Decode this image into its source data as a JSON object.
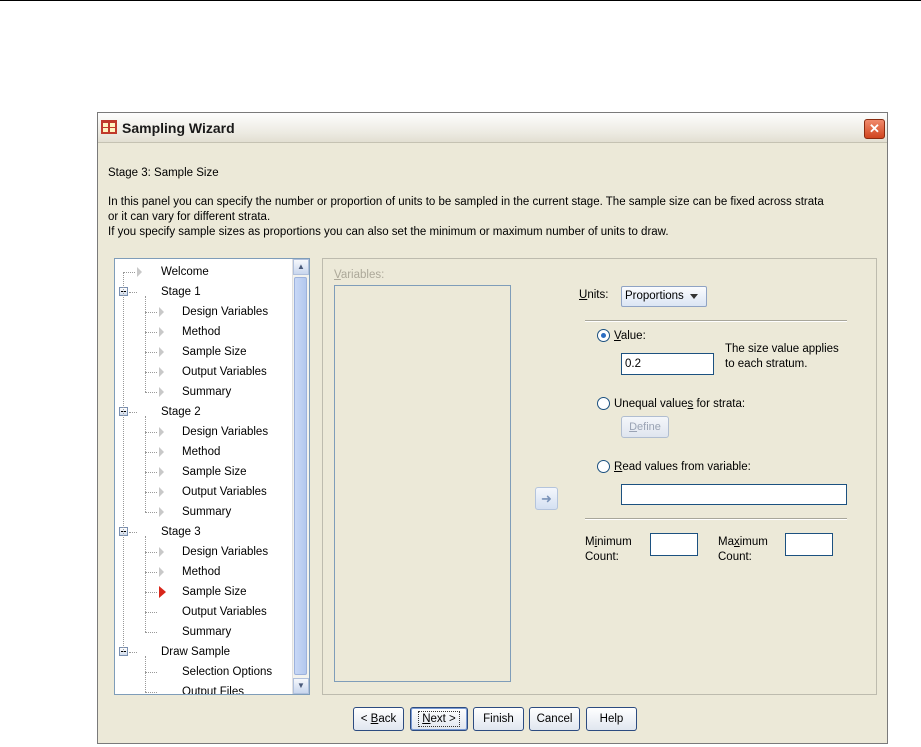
{
  "window": {
    "title": "Sampling Wizard",
    "close_glyph": "✕"
  },
  "stage_title": "Stage 3: Sample Size",
  "intro": {
    "line1": "In this panel you can specify the number or proportion of units to be sampled in the current stage. The sample size can be fixed across strata",
    "line2": "or it can vary for different strata.",
    "line3": "If you specify sample sizes as proportions you can also set the minimum or maximum number of units to draw."
  },
  "tree": {
    "items": [
      {
        "label": "Welcome",
        "level": 0,
        "kind": "leaf"
      },
      {
        "label": "Stage 1",
        "level": 0,
        "kind": "group"
      },
      {
        "label": "Design Variables",
        "level": 1,
        "kind": "leaf"
      },
      {
        "label": "Method",
        "level": 1,
        "kind": "leaf"
      },
      {
        "label": "Sample Size",
        "level": 1,
        "kind": "leaf"
      },
      {
        "label": "Output Variables",
        "level": 1,
        "kind": "leaf"
      },
      {
        "label": "Summary",
        "level": 1,
        "kind": "leaf"
      },
      {
        "label": "Stage 2",
        "level": 0,
        "kind": "group"
      },
      {
        "label": "Design Variables",
        "level": 1,
        "kind": "leaf"
      },
      {
        "label": "Method",
        "level": 1,
        "kind": "leaf"
      },
      {
        "label": "Sample Size",
        "level": 1,
        "kind": "leaf"
      },
      {
        "label": "Output Variables",
        "level": 1,
        "kind": "leaf"
      },
      {
        "label": "Summary",
        "level": 1,
        "kind": "leaf"
      },
      {
        "label": "Stage 3",
        "level": 0,
        "kind": "group"
      },
      {
        "label": "Design Variables",
        "level": 1,
        "kind": "leaf"
      },
      {
        "label": "Method",
        "level": 1,
        "kind": "leaf"
      },
      {
        "label": "Sample Size",
        "level": 1,
        "kind": "active"
      },
      {
        "label": "Output Variables",
        "level": 1,
        "kind": "plain"
      },
      {
        "label": "Summary",
        "level": 1,
        "kind": "plain"
      },
      {
        "label": "Draw Sample",
        "level": 0,
        "kind": "group"
      },
      {
        "label": "Selection Options",
        "level": 1,
        "kind": "plain"
      },
      {
        "label": "Output Files",
        "level": 1,
        "kind": "plain"
      }
    ]
  },
  "variables": {
    "label_pre": "",
    "label_u": "V",
    "label_post": "ariables:"
  },
  "units": {
    "label_u": "U",
    "label_post": "nits:",
    "selected": "Proportions"
  },
  "value_option": {
    "label_u": "V",
    "label_post": "alue:",
    "input_value": "0.2",
    "note_line1": "The size value applies",
    "note_line2": "to each stratum."
  },
  "unequal_option": {
    "label_pre": "Unequal value",
    "label_u": "s",
    "label_post": " for strata:",
    "define_pre": "",
    "define_u": "D",
    "define_post": "efine"
  },
  "read_option": {
    "label_u": "R",
    "label_post": "ead values from variable:",
    "input_value": ""
  },
  "minimum": {
    "line1_pre": "M",
    "line1_u": "i",
    "line1_post": "nimum",
    "line2": "Count:",
    "value": ""
  },
  "maximum": {
    "line1_pre": "Ma",
    "line1_u": "x",
    "line1_post": "imum",
    "line2": "Count:",
    "value": ""
  },
  "footer": {
    "back_pre": "< ",
    "back_u": "B",
    "back_post": "ack",
    "next_u": "N",
    "next_post": "ext >",
    "finish": "Finish",
    "cancel": "Cancel",
    "help": "Help"
  },
  "colors": {
    "dialog_bg": "#ece9d8",
    "active_marker": "#d8261a",
    "close_button": "#d0451f"
  }
}
